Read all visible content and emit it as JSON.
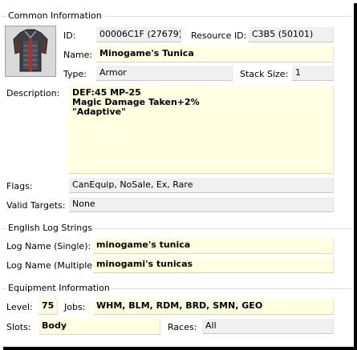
{
  "common": {
    "title": "Common Information",
    "id_label": "ID:",
    "id_value": "00006C1F (27679)",
    "resource_label": "Resource ID:",
    "resource_value": "C3B5 (50101)",
    "name_label": "Name:",
    "name_value": "Minogame's Tunica",
    "type_label": "Type:",
    "type_value": "Armor",
    "stack_label": "Stack Size:",
    "stack_value": "1",
    "description_label": "Description:",
    "description_value": "DEF:45 MP-25\nMagic Damage Taken+2%\n\"Adaptive\"",
    "flags_label": "Flags:",
    "flags_value": "CanEquip, NoSale, Ex, Rare",
    "valid_targets_label": "Valid Targets:",
    "valid_targets_value": "None",
    "icon": "tunica-armor-icon"
  },
  "log": {
    "title": "English Log Strings",
    "single_label": "Log Name (Single):",
    "single_value": "minogame's tunica",
    "multiple_label": "Log Name (Multiple):",
    "multiple_value": "minogami's tunicas"
  },
  "equipment": {
    "title": "Equipment Information",
    "level_label": "Level:",
    "level_value": "75",
    "jobs_label": "Jobs:",
    "jobs_value": "WHM, BLM, RDM, BRD, SMN, GEO",
    "slots_label": "Slots:",
    "slots_value": "Body",
    "races_label": "Races:",
    "races_value": "All"
  }
}
